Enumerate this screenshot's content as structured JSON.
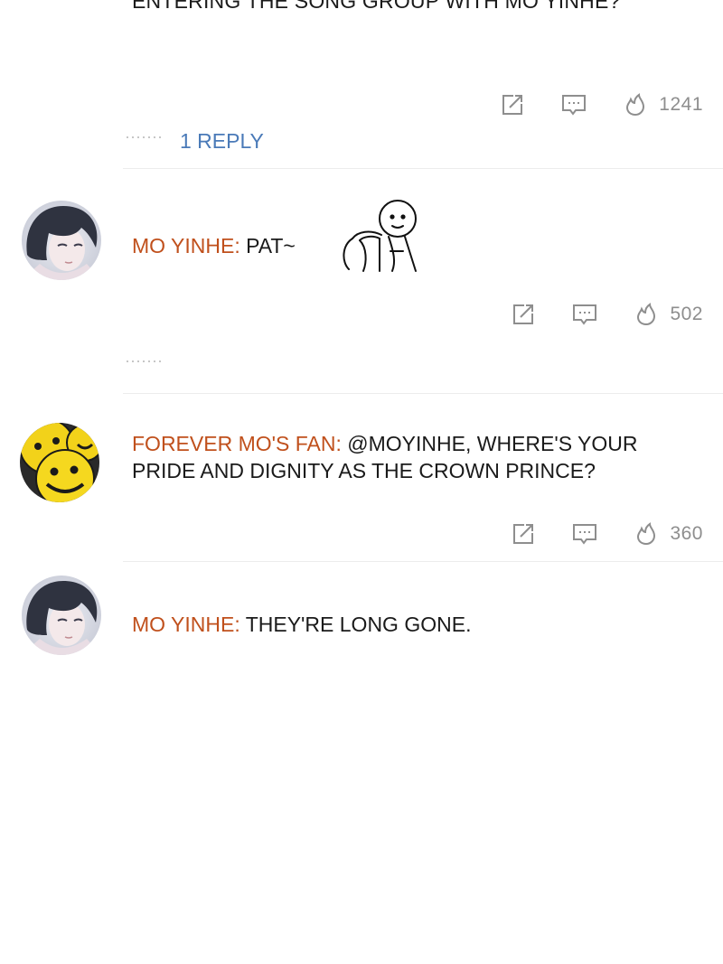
{
  "thread": {
    "top_text": "ENTERING THE SONG GROUP WITH MO YINHE?",
    "top_likes": "1241",
    "reply_count_label": "1 REPLY"
  },
  "comments": [
    {
      "username": "MO YINHE:",
      "text": " PAT~",
      "likes": "502",
      "avatar_icon": "anime-boy-avatar",
      "sticker": "pat-head-sticker"
    },
    {
      "username": "FOREVER MO'S FAN:",
      "text": " @MOYINHE, WHERE'S YOUR PRIDE AND DIGNITY AS THE CROWN PRINCE?",
      "likes": "360",
      "avatar_icon": "smiley-faces-avatar"
    },
    {
      "username": "MO YINHE:",
      "text": " THEY'RE LONG GONE.",
      "avatar_icon": "anime-boy-avatar"
    }
  ],
  "icons": {
    "share": "share-icon",
    "comment": "comment-icon",
    "like": "fire-like-icon"
  },
  "colors": {
    "username": "#c0501c",
    "reply_link": "#4a7ab8",
    "meta_gray": "#8e8e8e"
  }
}
